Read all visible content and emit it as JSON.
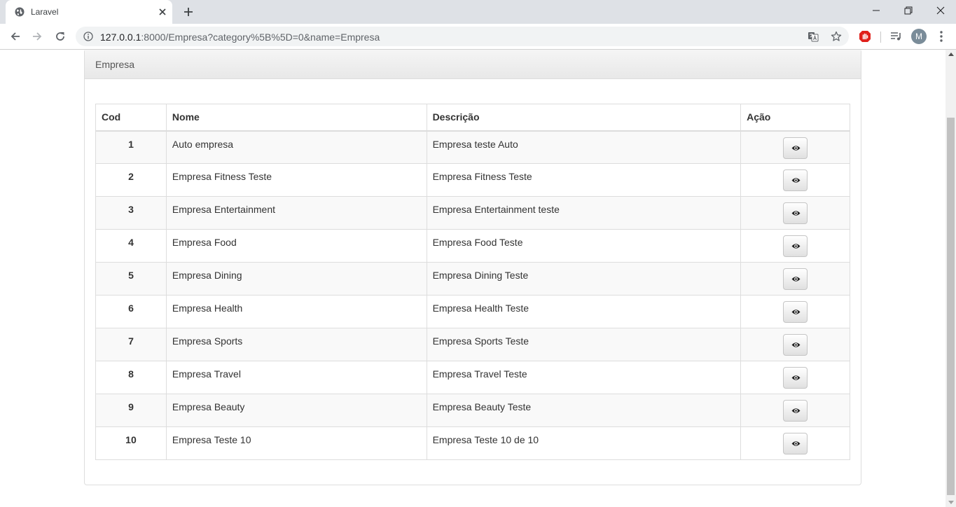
{
  "browser": {
    "tab_title": "Laravel",
    "url_host": "127.0.0.1",
    "url_rest": ":8000/Empresa?category%5B%5D=0&name=Empresa",
    "avatar_letter": "M"
  },
  "panel": {
    "heading": "Empresa"
  },
  "table": {
    "headers": [
      "Cod",
      "Nome",
      "Descrição",
      "Ação"
    ],
    "rows": [
      {
        "cod": "1",
        "nome": "Auto empresa",
        "descricao": "Empresa teste Auto"
      },
      {
        "cod": "2",
        "nome": "Empresa Fitness Teste",
        "descricao": "Empresa Fitness Teste"
      },
      {
        "cod": "3",
        "nome": "Empresa Entertainment",
        "descricao": "Empresa Entertainment teste"
      },
      {
        "cod": "4",
        "nome": "Empresa Food",
        "descricao": "Empresa Food Teste"
      },
      {
        "cod": "5",
        "nome": "Empresa Dining",
        "descricao": "Empresa Dining Teste"
      },
      {
        "cod": "6",
        "nome": "Empresa Health",
        "descricao": "Empresa Health Teste"
      },
      {
        "cod": "7",
        "nome": "Empresa Sports",
        "descricao": "Empresa Sports Teste"
      },
      {
        "cod": "8",
        "nome": "Empresa Travel",
        "descricao": "Empresa Travel Teste"
      },
      {
        "cod": "9",
        "nome": "Empresa Beauty",
        "descricao": "Empresa Beauty Teste"
      },
      {
        "cod": "10",
        "nome": "Empresa Teste 10",
        "descricao": "Empresa Teste 10 de 10"
      }
    ],
    "action_icon": "eye-icon"
  },
  "colors": {
    "tabstrip": "#dee1e6",
    "panel_border": "#dddddd",
    "stripe": "#f9f9f9",
    "avatar": "#7a8c99"
  }
}
